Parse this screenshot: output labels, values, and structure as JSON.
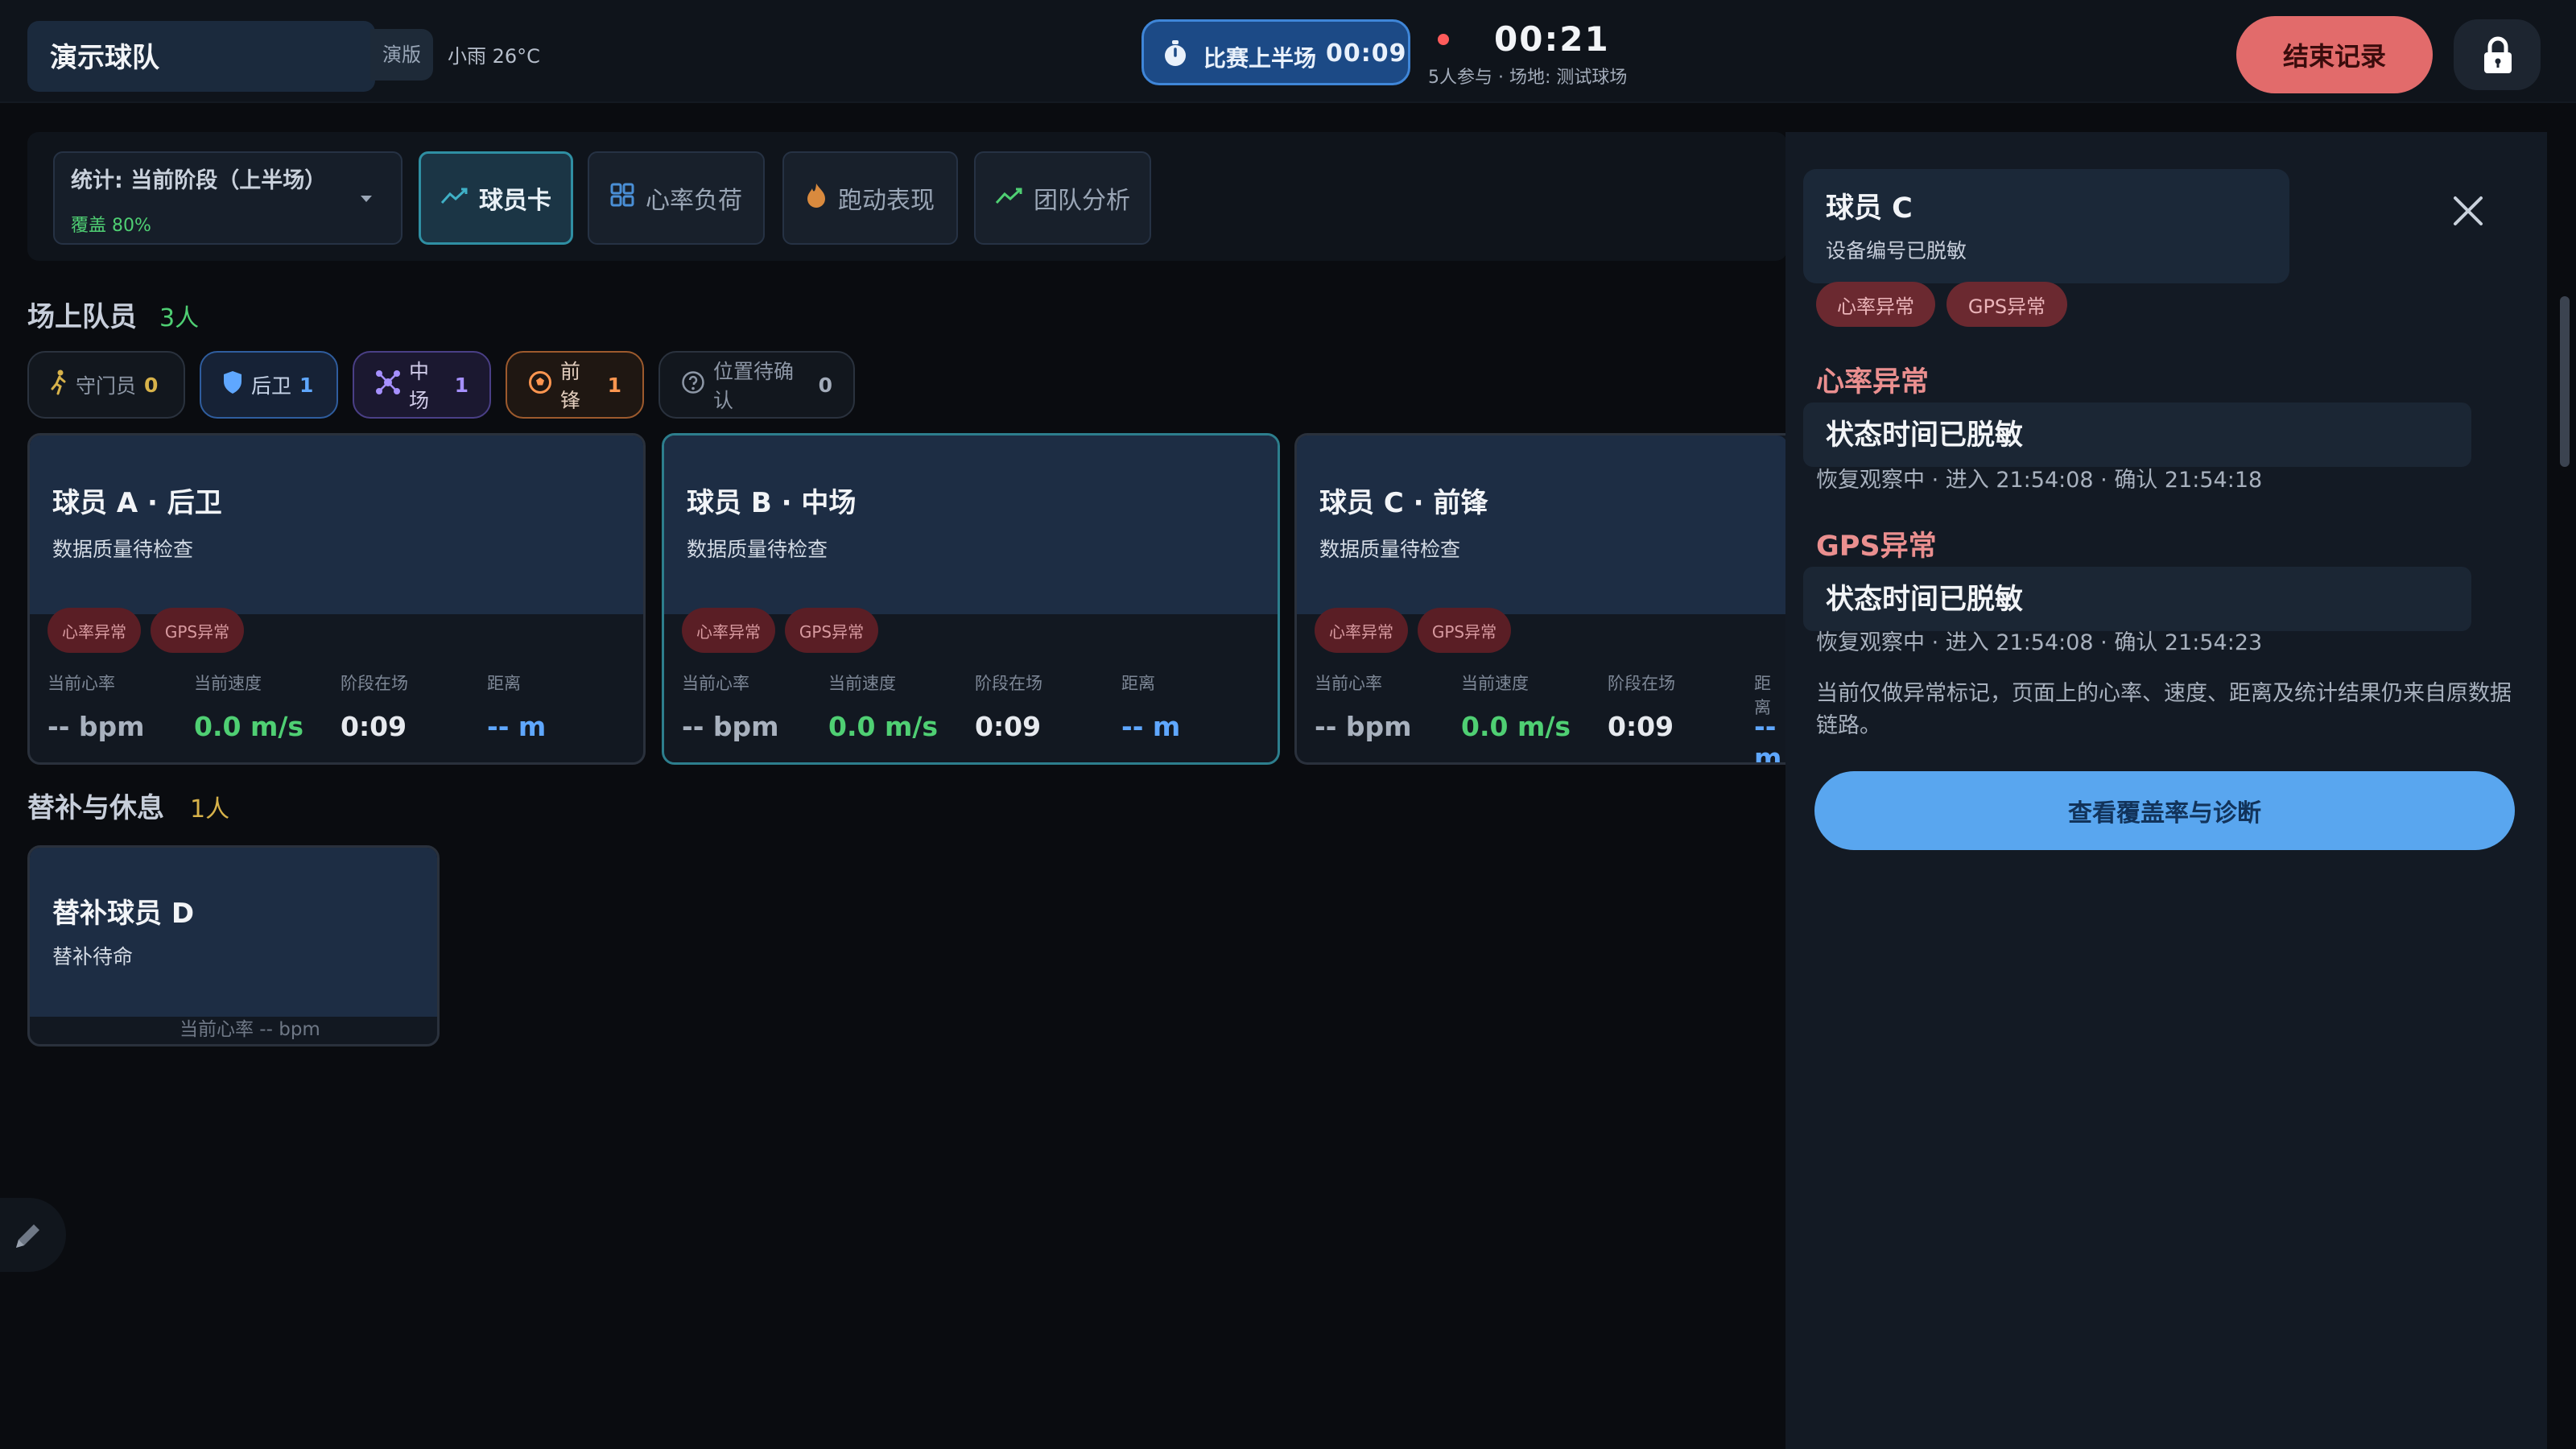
{
  "header": {
    "team_name": "演示球队",
    "edition": "演版",
    "weather": "小雨 26°C",
    "half_label": "比赛上半场",
    "half_time": "00:09",
    "elapsed": "00:21",
    "session_info": "5人参与 · 场地: 测试球场",
    "end_label": "结束记录"
  },
  "toolbar": {
    "stats_label": "统计: 当前阶段（上半场）",
    "coverage": "覆盖 80%",
    "tabs": [
      {
        "label": "球员卡",
        "active": true
      },
      {
        "label": "心率负荷",
        "active": false
      },
      {
        "label": "跑动表现",
        "active": false
      },
      {
        "label": "团队分析",
        "active": false
      }
    ]
  },
  "onfield": {
    "title": "场上队员",
    "count": "3人",
    "chips": [
      {
        "label": "守门员",
        "count": "0"
      },
      {
        "label": "后卫",
        "count": "1"
      },
      {
        "label": "中场",
        "count": "1"
      },
      {
        "label": "前锋",
        "count": "1"
      },
      {
        "label": "位置待确认",
        "count": "0"
      }
    ]
  },
  "stat_labels": [
    "当前心率",
    "当前速度",
    "阶段在场",
    "距离"
  ],
  "players": [
    {
      "name": "球员 A · 后卫",
      "subtitle": "数据质量待检查",
      "badges": [
        "心率异常",
        "GPS异常"
      ],
      "hr": "-- bpm",
      "speed": "0.0 m/s",
      "time": "0:09",
      "distance": "-- m"
    },
    {
      "name": "球员 B · 中场",
      "subtitle": "数据质量待检查",
      "badges": [
        "心率异常",
        "GPS异常"
      ],
      "hr": "-- bpm",
      "speed": "0.0 m/s",
      "time": "0:09",
      "distance": "-- m"
    },
    {
      "name": "球员 C · 前锋",
      "subtitle": "数据质量待检查",
      "badges": [
        "心率异常",
        "GPS异常"
      ],
      "hr": "-- bpm",
      "speed": "0.0 m/s",
      "time": "0:09",
      "distance": "-- m"
    }
  ],
  "bench": {
    "title": "替补与休息",
    "count": "1人",
    "player": {
      "name": "替补球员 D",
      "subtitle": "替补待命",
      "hr_line": "当前心率 -- bpm"
    }
  },
  "panel": {
    "title": "球员 C",
    "device": "设备编号已脱敏",
    "tags": [
      "心率异常",
      "GPS异常"
    ],
    "sections": [
      {
        "title": "心率异常",
        "status": "状态时间已脱敏",
        "detail": "恢复观察中 · 进入 21:54:08 · 确认 21:54:18"
      },
      {
        "title": "GPS异常",
        "status": "状态时间已脱敏",
        "detail": "恢复观察中 · 进入 21:54:08 · 确认 21:54:23"
      }
    ],
    "note": "当前仅做异常标记，页面上的心率、速度、距离及统计结果仍来自原数据链路。",
    "button_label": "查看覆盖率与诊断"
  },
  "colors": {
    "accent_green": "#4fcf73",
    "accent_blue": "#5fa7ff",
    "alert_red": "#e26b6b",
    "primary_button": "#59a6ef"
  }
}
